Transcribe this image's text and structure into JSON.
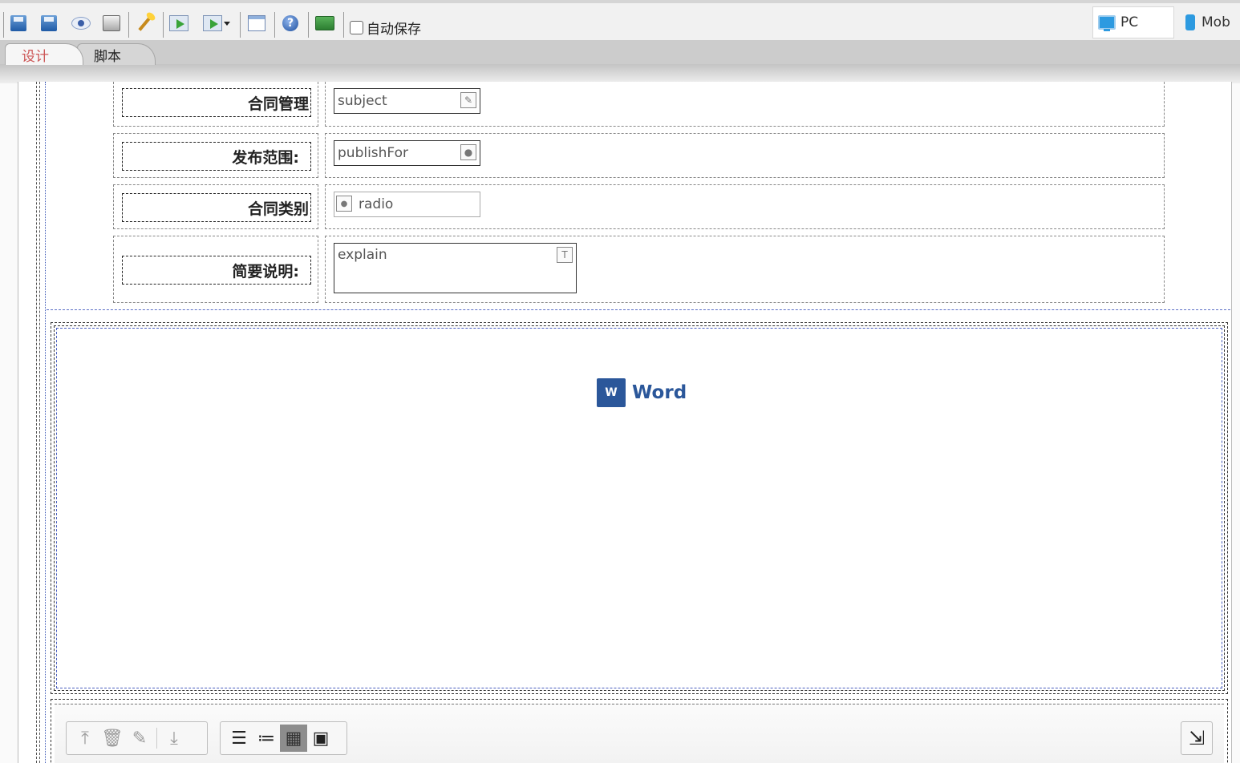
{
  "toolbar": {
    "buttons": [
      {
        "name": "save-button",
        "icon": "save-icon"
      },
      {
        "name": "save-as-button",
        "icon": "save-as-icon"
      },
      {
        "name": "preview-button",
        "icon": "eye-icon"
      },
      {
        "name": "print-button",
        "icon": "print-icon"
      },
      {
        "name": "wizard-button",
        "icon": "wand-icon"
      },
      {
        "name": "import-button",
        "icon": "import-icon"
      },
      {
        "name": "export-button",
        "icon": "export-icon"
      },
      {
        "name": "form-list-button",
        "icon": "list-icon"
      },
      {
        "name": "help-button",
        "icon": "help-icon"
      },
      {
        "name": "layer-button",
        "icon": "layer-icon"
      }
    ],
    "autosave_label": "自动保存",
    "autosave_checked": false,
    "view_pc_label": "PC",
    "view_mobile_label": "Mob"
  },
  "tabs": [
    {
      "label": "设计",
      "active": true
    },
    {
      "label": "脚本",
      "active": false
    }
  ],
  "form": {
    "rows": [
      {
        "label": "合同管理",
        "field": "subject",
        "field_type": "text",
        "icon": "edit-icon"
      },
      {
        "label": "发布范围:",
        "field": "publishFor",
        "field_type": "person",
        "icon": "person-icon"
      },
      {
        "label": "合同类别",
        "field": "radio",
        "field_type": "radio",
        "icon": "radio-icon"
      },
      {
        "label": "简要说明:",
        "field": "explain",
        "field_type": "textarea",
        "icon": "textarea-icon"
      }
    ]
  },
  "word": {
    "icon_letter": "W",
    "label": "Word"
  },
  "attachment_toolbar": {
    "icons": [
      "upload-icon",
      "delete-icon",
      "edit-icon",
      "download-icon",
      "list-view-icon",
      "detail-list-icon",
      "grid-view-icon",
      "image-view-icon",
      "collapse-icon"
    ],
    "active_view": "grid-view"
  },
  "colors": {
    "accent": "#2b579a",
    "active_tab_text": "#cc5555",
    "guide_blue": "#4a5fbf"
  }
}
